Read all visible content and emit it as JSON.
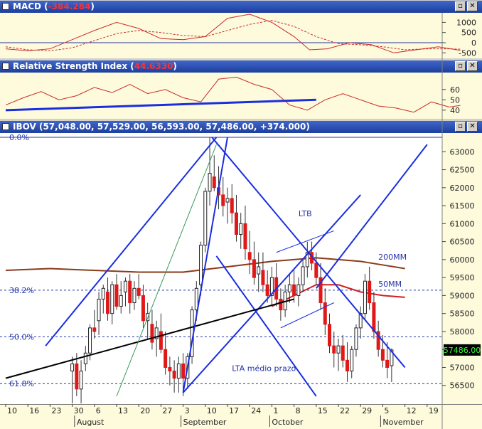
{
  "panels": {
    "macd": {
      "name": "MACD",
      "value": "-384.284"
    },
    "rsi": {
      "name": "Relative Strength Index",
      "value": "44.6330"
    },
    "price": {
      "name": "IBOV",
      "value": "57,048.00, 57,529.00, 56,593.00, 57,486.00, +374.000"
    }
  },
  "window_buttons": {
    "restore": "▫",
    "close": "✕"
  },
  "chart_data": [
    {
      "type": "line",
      "panel": "MACD",
      "y_ticks": [
        "1000",
        "500",
        "0",
        "-500"
      ],
      "ylim": [
        -700,
        1400
      ],
      "series": [
        {
          "name": "MACD",
          "style": "solid",
          "color": "#cc2a2a",
          "x": [
            0,
            10,
            20,
            30,
            40,
            50,
            60,
            70,
            80,
            90,
            100,
            110,
            120,
            130,
            137,
            145,
            155,
            165,
            175,
            185,
            195,
            205
          ],
          "values": [
            -300,
            -400,
            -300,
            150,
            600,
            1000,
            700,
            200,
            150,
            300,
            1200,
            1400,
            1000,
            300,
            -350,
            -300,
            0,
            -100,
            -500,
            -350,
            -200,
            -380
          ]
        },
        {
          "name": "Signal",
          "style": "dashed",
          "color": "#cc2a2a",
          "x": [
            0,
            10,
            20,
            30,
            40,
            50,
            60,
            70,
            80,
            90,
            100,
            110,
            120,
            130,
            140,
            150,
            160,
            170,
            180,
            190,
            200,
            205
          ],
          "values": [
            -200,
            -350,
            -400,
            -250,
            100,
            450,
            600,
            500,
            350,
            300,
            600,
            900,
            1100,
            800,
            300,
            -50,
            -100,
            -200,
            -350,
            -300,
            -300,
            -320
          ]
        }
      ]
    },
    {
      "type": "line",
      "panel": "Relative Strength Index",
      "y_ticks": [
        "60",
        "50",
        "40"
      ],
      "ylim": [
        33,
        75
      ],
      "series": [
        {
          "name": "RSI",
          "color": "#cc2a2a",
          "x": [
            0,
            8,
            16,
            24,
            32,
            40,
            48,
            56,
            64,
            72,
            80,
            88,
            96,
            104,
            112,
            120,
            128,
            136,
            144,
            152,
            160,
            168,
            176,
            184,
            192,
            200,
            205
          ],
          "values": [
            45,
            52,
            58,
            50,
            54,
            62,
            57,
            65,
            56,
            60,
            52,
            48,
            70,
            72,
            65,
            60,
            45,
            40,
            50,
            56,
            50,
            44,
            42,
            38,
            48,
            43,
            44.6
          ]
        }
      ],
      "trendline": {
        "from": [
          0,
          40
        ],
        "to": [
          140,
          50
        ],
        "color": "#1a2ee0"
      }
    },
    {
      "type": "candlestick",
      "panel": "IBOV",
      "ylim": [
        56000,
        63500
      ],
      "y_ticks": [
        63000,
        62500,
        62000,
        61500,
        61000,
        60500,
        60000,
        59500,
        59000,
        58500,
        58000,
        57500,
        57000,
        56500
      ],
      "last_value": "57486.00",
      "x_ticks": [
        {
          "x": 0,
          "label": "10"
        },
        {
          "x": 10,
          "label": "16"
        },
        {
          "x": 20,
          "label": "23"
        },
        {
          "x": 30,
          "label": "30"
        },
        {
          "x": 40,
          "label": "6"
        },
        {
          "x": 50,
          "label": "13"
        },
        {
          "x": 60,
          "label": "20"
        },
        {
          "x": 70,
          "label": "27"
        },
        {
          "x": 80,
          "label": "3"
        },
        {
          "x": 90,
          "label": "10"
        },
        {
          "x": 100,
          "label": "17"
        },
        {
          "x": 110,
          "label": "24"
        },
        {
          "x": 120,
          "label": "1"
        },
        {
          "x": 130,
          "label": "8"
        },
        {
          "x": 140,
          "label": "15"
        },
        {
          "x": 150,
          "label": "22"
        },
        {
          "x": 160,
          "label": "29"
        },
        {
          "x": 170,
          "label": "5"
        },
        {
          "x": 180,
          "label": "12"
        },
        {
          "x": 190,
          "label": "19"
        }
      ],
      "months": [
        {
          "x": 32,
          "label": "August"
        },
        {
          "x": 80,
          "label": "September"
        },
        {
          "x": 120,
          "label": "October"
        },
        {
          "x": 170,
          "label": "November"
        }
      ],
      "fib_levels": [
        {
          "label": "0.0%",
          "value": 63400
        },
        {
          "label": "38.2%",
          "value": 59150
        },
        {
          "label": "50.0%",
          "value": 57850
        },
        {
          "label": "61.8%",
          "value": 56550
        }
      ],
      "annotations": [
        {
          "text": "LTB",
          "x": 132,
          "y": 61200
        },
        {
          "text": "200MM",
          "x": 168,
          "y": 60000
        },
        {
          "text": "50MM",
          "x": 168,
          "y": 59250
        },
        {
          "text": "LTA médio prazo",
          "x": 102,
          "y": 56900
        }
      ],
      "candles": [
        [
          30,
          56900,
          57300,
          56000,
          57100
        ],
        [
          32,
          57100,
          57400,
          56200,
          56400
        ],
        [
          34,
          56400,
          57200,
          56000,
          56900
        ],
        [
          36,
          57100,
          57600,
          56900,
          57400
        ],
        [
          38,
          57400,
          58200,
          57200,
          58100
        ],
        [
          40,
          58100,
          58600,
          57800,
          58000
        ],
        [
          42,
          58300,
          59100,
          57900,
          58900
        ],
        [
          44,
          58900,
          59300,
          58500,
          59200
        ],
        [
          46,
          59100,
          59500,
          58300,
          58500
        ],
        [
          48,
          58500,
          59400,
          58200,
          59300
        ],
        [
          50,
          59300,
          59600,
          58600,
          58700
        ],
        [
          52,
          58700,
          59400,
          58500,
          59000
        ],
        [
          54,
          59100,
          59500,
          58700,
          59400
        ],
        [
          56,
          59400,
          59600,
          58500,
          58800
        ],
        [
          58,
          58800,
          59400,
          58600,
          59200
        ],
        [
          60,
          59200,
          59600,
          58900,
          59000
        ],
        [
          62,
          59000,
          59300,
          58100,
          58300
        ],
        [
          64,
          58300,
          58800,
          57800,
          58500
        ],
        [
          66,
          58200,
          58600,
          57500,
          57700
        ],
        [
          68,
          57800,
          58300,
          57300,
          58100
        ],
        [
          70,
          58000,
          58500,
          57400,
          57500
        ],
        [
          72,
          57500,
          58000,
          56800,
          57000
        ],
        [
          74,
          57000,
          57300,
          56500,
          56900
        ],
        [
          76,
          56900,
          57200,
          56300,
          56700
        ],
        [
          78,
          56700,
          57300,
          56300,
          57100
        ],
        [
          80,
          57100,
          57400,
          56200,
          56700
        ],
        [
          82,
          56700,
          57400,
          56400,
          57300
        ],
        [
          84,
          57300,
          58700,
          57100,
          58600
        ],
        [
          86,
          58600,
          59400,
          58300,
          59200
        ],
        [
          88,
          59300,
          60500,
          59000,
          60400
        ],
        [
          90,
          60400,
          62000,
          60200,
          61900
        ],
        [
          92,
          61900,
          63400,
          61500,
          62400
        ],
        [
          94,
          62300,
          62900,
          61900,
          62000
        ],
        [
          96,
          62000,
          62600,
          61400,
          61800
        ],
        [
          98,
          61800,
          62300,
          61200,
          61500
        ],
        [
          100,
          61600,
          62000,
          61000,
          61700
        ],
        [
          102,
          61700,
          62100,
          61000,
          61300
        ],
        [
          104,
          61300,
          61800,
          60500,
          60700
        ],
        [
          106,
          60700,
          61300,
          60300,
          61000
        ],
        [
          108,
          61000,
          61500,
          60000,
          60300
        ],
        [
          110,
          60200,
          60800,
          59600,
          60000
        ],
        [
          112,
          60000,
          60500,
          59300,
          59500
        ],
        [
          114,
          59600,
          60200,
          59100,
          59800
        ],
        [
          116,
          59700,
          60200,
          59100,
          59300
        ],
        [
          118,
          59300,
          59700,
          58800,
          59000
        ],
        [
          120,
          59000,
          59800,
          58700,
          59500
        ],
        [
          122,
          59500,
          59900,
          58700,
          58900
        ],
        [
          124,
          58900,
          59200,
          58300,
          58600
        ],
        [
          126,
          58600,
          59300,
          58400,
          59100
        ],
        [
          128,
          59100,
          59600,
          58800,
          59300
        ],
        [
          130,
          59300,
          59700,
          58800,
          59000
        ],
        [
          132,
          59000,
          59500,
          58700,
          59300
        ],
        [
          134,
          59300,
          60000,
          59100,
          59800
        ],
        [
          136,
          59800,
          60500,
          59500,
          60200
        ],
        [
          138,
          60200,
          60500,
          59700,
          59900
        ],
        [
          140,
          59900,
          60200,
          59300,
          59500
        ],
        [
          142,
          59500,
          59900,
          58600,
          58800
        ],
        [
          144,
          58800,
          59200,
          57900,
          58200
        ],
        [
          146,
          58200,
          58500,
          57400,
          57600
        ],
        [
          148,
          57600,
          58000,
          57000,
          57400
        ],
        [
          150,
          57400,
          57800,
          56900,
          57600
        ],
        [
          152,
          57600,
          57900,
          57000,
          57200
        ],
        [
          154,
          57200,
          57700,
          56600,
          56900
        ],
        [
          156,
          56900,
          57600,
          56700,
          57500
        ],
        [
          158,
          57500,
          58200,
          57300,
          58100
        ],
        [
          160,
          58100,
          58700,
          57800,
          58500
        ],
        [
          162,
          58500,
          59600,
          58300,
          59400
        ],
        [
          164,
          59400,
          59800,
          58600,
          58800
        ],
        [
          166,
          58800,
          59100,
          57800,
          58000
        ],
        [
          168,
          58000,
          58300,
          57300,
          57500
        ],
        [
          170,
          57500,
          57900,
          57000,
          57200
        ],
        [
          172,
          57200,
          57700,
          56700,
          57000
        ],
        [
          174,
          57048,
          57529,
          56593,
          57486
        ]
      ],
      "ma200": {
        "name": "200MM",
        "x": [
          0,
          20,
          40,
          60,
          80,
          100,
          120,
          140,
          160,
          170,
          180
        ],
        "values": [
          59700,
          59750,
          59700,
          59650,
          59650,
          59800,
          59950,
          60050,
          59950,
          59850,
          59750
        ]
      },
      "ma50": {
        "name": "50MM",
        "x": [
          120,
          130,
          140,
          150,
          160,
          170,
          180
        ],
        "values": [
          58700,
          59000,
          59300,
          59300,
          59100,
          59000,
          58950
        ]
      },
      "trendlines": [
        {
          "name": "LTB",
          "from": [
            93,
            63400
          ],
          "to": [
            180,
            57000
          ],
          "color": "#1a2ee0"
        },
        {
          "name": "LTA médio prazo",
          "from": [
            80,
            56300
          ],
          "to": [
            160,
            61800
          ],
          "color": "#1a2ee0"
        },
        {
          "name": "channel-upper-left",
          "from": [
            18,
            57600
          ],
          "to": [
            95,
            63400
          ],
          "color": "#1a2ee0"
        },
        {
          "name": "channel-lower",
          "from": [
            95,
            60100
          ],
          "to": [
            140,
            56200
          ],
          "color": "#1a2ee0"
        },
        {
          "name": "long-up",
          "from": [
            140,
            59200
          ],
          "to": [
            190,
            63200
          ],
          "color": "#1a2ee0"
        },
        {
          "name": "long-term-black",
          "from": [
            0,
            56700
          ],
          "to": [
            130,
            58900
          ],
          "color": "#000000"
        },
        {
          "name": "steep-blue",
          "from": [
            80,
            56300
          ],
          "to": [
            100,
            63400
          ],
          "color": "#1a2ee0"
        },
        {
          "name": "steep-green",
          "from": [
            50,
            56200
          ],
          "to": [
            95,
            63200
          ],
          "color": "#3a9a5a"
        },
        {
          "name": "flag-upper",
          "from": [
            122,
            60200
          ],
          "to": [
            148,
            60800
          ],
          "color": "#1a2ee0"
        },
        {
          "name": "flag-lower",
          "from": [
            124,
            58100
          ],
          "to": [
            148,
            58800
          ],
          "color": "#1a2ee0"
        }
      ]
    }
  ]
}
